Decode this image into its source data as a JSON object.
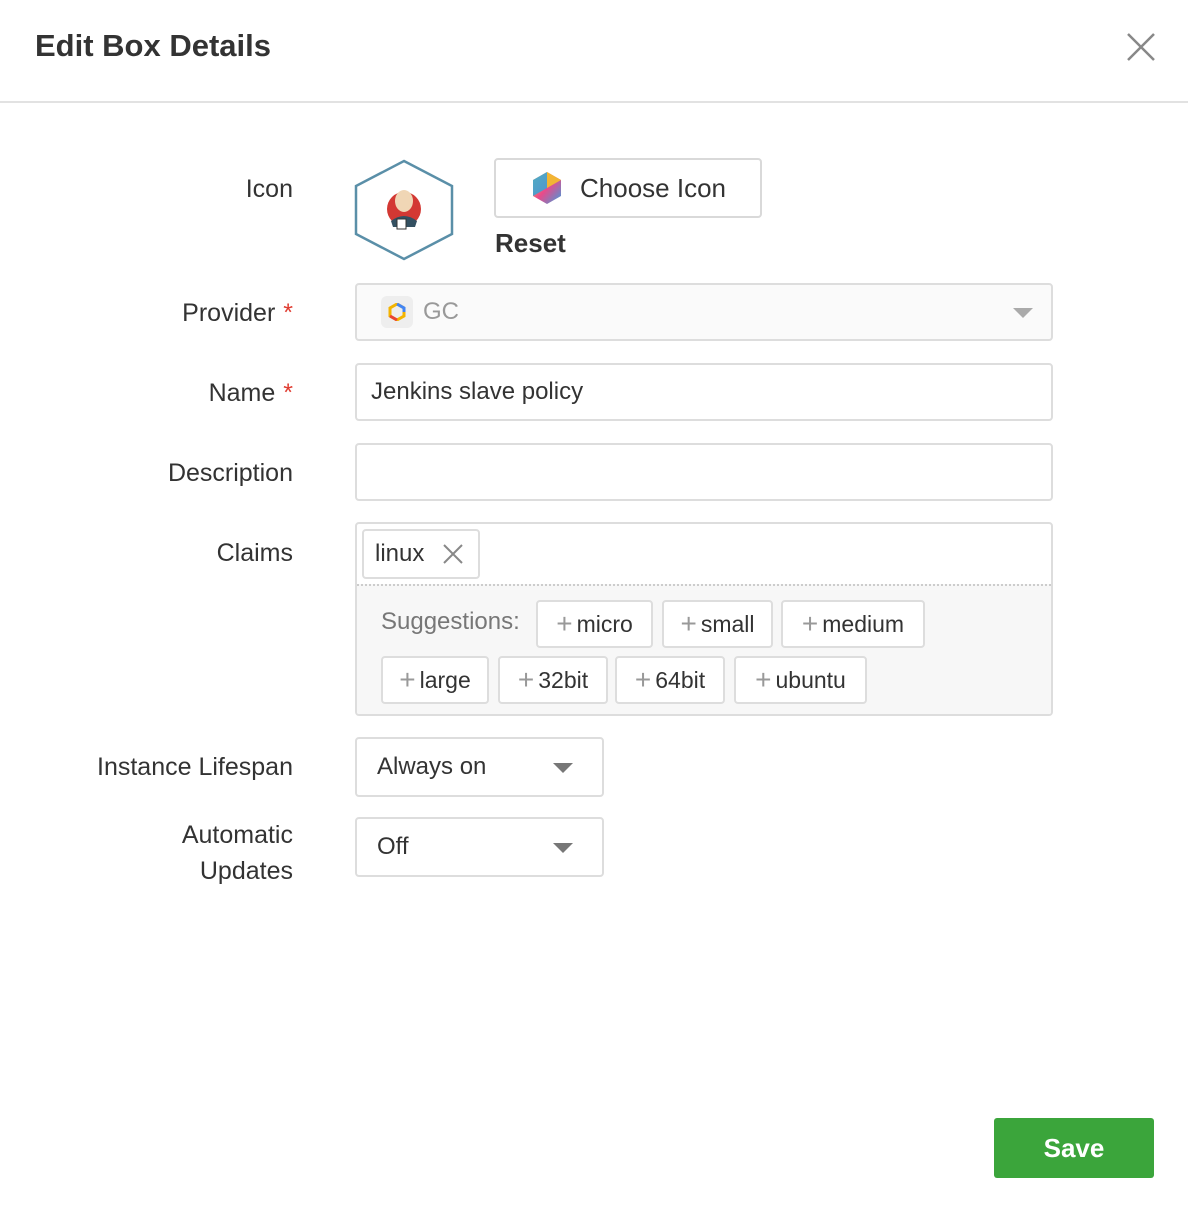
{
  "header": {
    "title": "Edit Box Details",
    "close_icon": "close-icon"
  },
  "form": {
    "icon": {
      "label": "Icon",
      "choose_label": "Choose Icon",
      "reset_label": "Reset",
      "current_icon": "jenkins-logo"
    },
    "provider": {
      "label": "Provider",
      "required": "*",
      "value": "GC",
      "icon": "google-cloud-icon"
    },
    "name": {
      "label": "Name",
      "required": "*",
      "value": "Jenkins slave policy"
    },
    "description": {
      "label": "Description",
      "value": ""
    },
    "claims": {
      "label": "Claims",
      "tags": [
        "linux"
      ],
      "suggestions_label": "Suggestions:",
      "suggestions": [
        "micro",
        "small",
        "medium",
        "large",
        "32bit",
        "64bit",
        "ubuntu"
      ]
    },
    "lifespan": {
      "label": "Instance Lifespan",
      "value": "Always on"
    },
    "updates": {
      "label_line1": "Automatic",
      "label_line2": "Updates",
      "value": "Off"
    }
  },
  "footer": {
    "save_label": "Save",
    "save_color": "#3ba53b"
  }
}
